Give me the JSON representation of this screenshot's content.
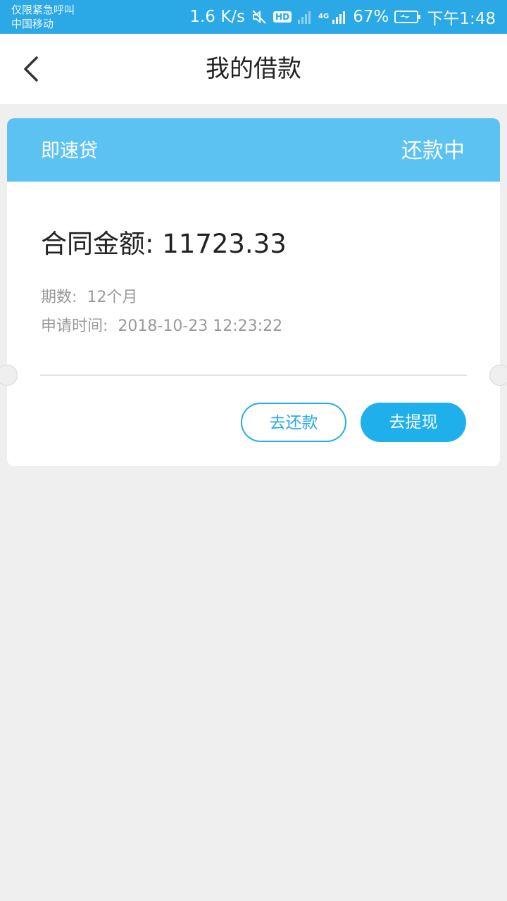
{
  "status_bar": {
    "line1": "仅限紧急呼叫",
    "line2": "中国移动",
    "net_speed": "1.6 K/s",
    "hd": "HD",
    "net_type": "4G",
    "battery": "67%",
    "time": "下午1:48"
  },
  "header": {
    "title": "我的借款"
  },
  "card": {
    "product": "即速贷",
    "status": "还款中",
    "amount_label": "合同金额:",
    "amount_value": "11723.33",
    "term_label": "期数:",
    "term_value": "12个月",
    "date_label": "申请时间:",
    "date_value": "2018-10-23 12:23:22",
    "repay_button": "去还款",
    "withdraw_button": "去提现"
  },
  "colors": {
    "status_bar": "#2ba8e6",
    "card_header": "#5cc2f2",
    "primary": "#1fb0ec"
  }
}
